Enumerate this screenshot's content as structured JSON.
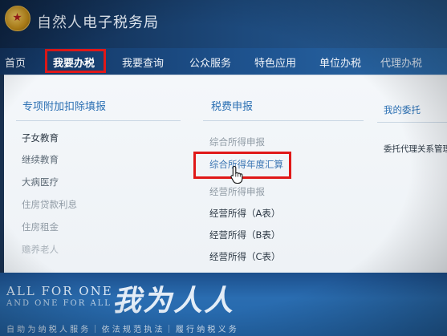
{
  "header": {
    "title": "自然人电子税务局"
  },
  "nav": {
    "items": [
      "首页",
      "我要办税",
      "我要查询",
      "公众服务",
      "特色应用",
      "单位办税",
      "代理办税"
    ],
    "active_index": 1
  },
  "dropdown": {
    "columns": [
      {
        "heading": "专项附加扣除填报",
        "items": [
          "子女教育",
          "继续教育",
          "大病医疗",
          "住房贷款利息",
          "住房租金",
          "赡养老人"
        ]
      },
      {
        "heading": "税费申报",
        "items": [
          "综合所得申报",
          "综合所得年度汇算",
          "经营所得申报",
          "经营所得（A表）",
          "经营所得（B表）",
          "经营所得（C表）"
        ],
        "highlighted_index": 1
      },
      {
        "heading": "我的委托",
        "items": [
          "委托代理关系管理"
        ]
      }
    ]
  },
  "banner": {
    "line1": "ALL FOR ONE",
    "line2": "AND ONE FOR ALL",
    "brush": "我为人人",
    "bottom": "自 助 为 纳 税 人 服 务 ｜ 依 法 规 范 执 法 ｜ 履 行 纳 税 义 务"
  },
  "colors": {
    "highlight_box": "#e01818",
    "link": "#3b75b3",
    "nav_bg": "#1f5592"
  }
}
